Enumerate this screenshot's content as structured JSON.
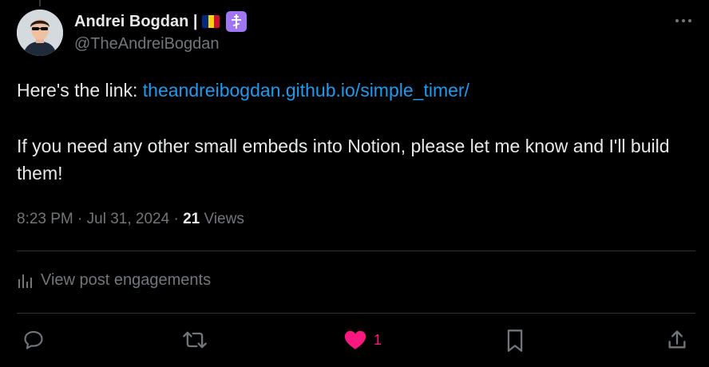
{
  "author": {
    "name": "Andrei Bogdan |",
    "handle": "@TheAndreiBogdan",
    "flag_colors": [
      "#002b7f",
      "#fcd116",
      "#ce1126"
    ]
  },
  "post": {
    "text_prefix": "Here's the link: ",
    "link_text": "theandreibogdan.github.io/simple_timer/",
    "paragraph2": "If you need any other small embeds into Notion, please let me know and I'll build them!"
  },
  "meta": {
    "time": "8:23 PM",
    "date": "Jul 31, 2024",
    "views_count": "21",
    "views_label": "Views"
  },
  "engagements": {
    "label": "View post engagements",
    "icon": "bar-chart-icon"
  },
  "actions": {
    "reply": {
      "icon": "reply-icon"
    },
    "repost": {
      "icon": "repost-icon"
    },
    "like": {
      "icon": "heart-filled-icon",
      "count": "1",
      "color": "#f91880"
    },
    "bookmark": {
      "icon": "bookmark-icon"
    },
    "share": {
      "icon": "share-icon"
    }
  },
  "colors": {
    "background": "#000000",
    "text": "#e7e9ea",
    "muted": "#71767b",
    "link": "#1d9bf0",
    "divider": "#2f3336",
    "badge": "#a076f2"
  }
}
